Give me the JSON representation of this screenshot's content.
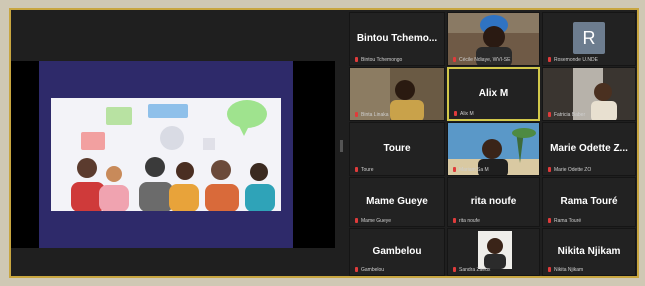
{
  "participants": [
    {
      "display": "Bintou Tchemo...",
      "label": "Bintou Tchemongo"
    },
    {
      "display": "",
      "label": "Cécile Ndiaye, WVI-SE"
    },
    {
      "display": "",
      "label": "Rosemonde U.NDE",
      "avatar_letter": "R"
    },
    {
      "display": "",
      "label": "Binta Linaka"
    },
    {
      "display": "Alix M",
      "label": "Alix M"
    },
    {
      "display": "",
      "label": "Fatricia Baber"
    },
    {
      "display": "Toure",
      "label": "Toure"
    },
    {
      "display": "",
      "label": "Mariam Sa M"
    },
    {
      "display": "Marie Odette Z...",
      "label": "Marie Odette ZO"
    },
    {
      "display": "Mame Gueye",
      "label": "Mame Gueye"
    },
    {
      "display": "rita noufe",
      "label": "rita noufe"
    },
    {
      "display": "Rama Touré",
      "label": "Rama Touré"
    },
    {
      "display": "Gambelou",
      "label": "Gambelou"
    },
    {
      "display": "",
      "label": "Sandra Zaeux"
    },
    {
      "display": "Nikita Njikam",
      "label": "Nikita Njikam"
    }
  ],
  "colors": {
    "active_speaker_border": "#d2c84a",
    "muted_mic": "#e03b3b",
    "slide_background": "#2e2a6a"
  }
}
